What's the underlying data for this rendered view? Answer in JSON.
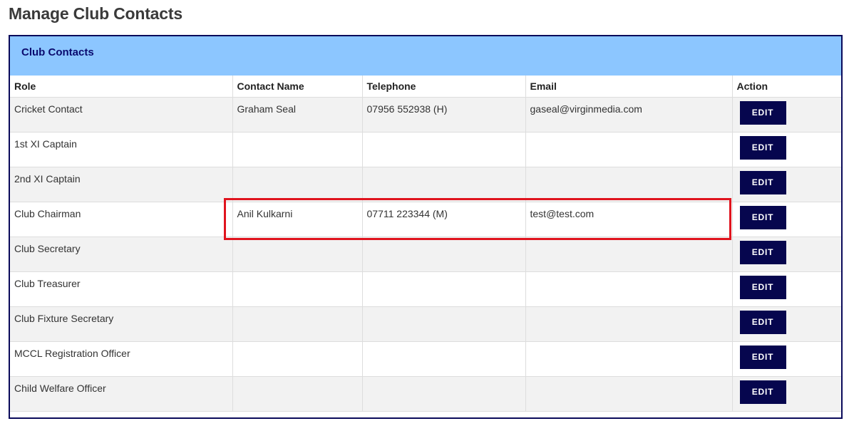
{
  "page": {
    "title": "Manage Club Contacts"
  },
  "panel": {
    "title": "Club Contacts"
  },
  "table": {
    "headers": [
      "Role",
      "Contact Name",
      "Telephone",
      "Email",
      "Action"
    ],
    "rows": [
      {
        "role": "Cricket Contact",
        "name": "Graham Seal",
        "telephone": "07956 552938 (H)",
        "email": "gaseal@virginmedia.com",
        "action": "EDIT"
      },
      {
        "role": "1st XI Captain",
        "name": "",
        "telephone": "",
        "email": "",
        "action": "EDIT"
      },
      {
        "role": "2nd XI Captain",
        "name": "",
        "telephone": "",
        "email": "",
        "action": "EDIT"
      },
      {
        "role": "Club Chairman",
        "name": "Anil Kulkarni",
        "telephone": "07711 223344 (M)",
        "email": "test@test.com",
        "action": "EDIT"
      },
      {
        "role": "Club Secretary",
        "name": "",
        "telephone": "",
        "email": "",
        "action": "EDIT"
      },
      {
        "role": "Club Treasurer",
        "name": "",
        "telephone": "",
        "email": "",
        "action": "EDIT"
      },
      {
        "role": "Club Fixture Secretary",
        "name": "",
        "telephone": "",
        "email": "",
        "action": "EDIT"
      },
      {
        "role": "MCCL Registration Officer",
        "name": "",
        "telephone": "",
        "email": "",
        "action": "EDIT"
      },
      {
        "role": "Child Welfare Officer",
        "name": "",
        "telephone": "",
        "email": "",
        "action": "EDIT"
      }
    ]
  },
  "colors": {
    "panel_border": "#0a0a5a",
    "panel_header_bg": "#8cc6ff",
    "button_bg": "#06064e",
    "highlight": "#e0141e",
    "row_alt_bg": "#f2f2f2"
  }
}
